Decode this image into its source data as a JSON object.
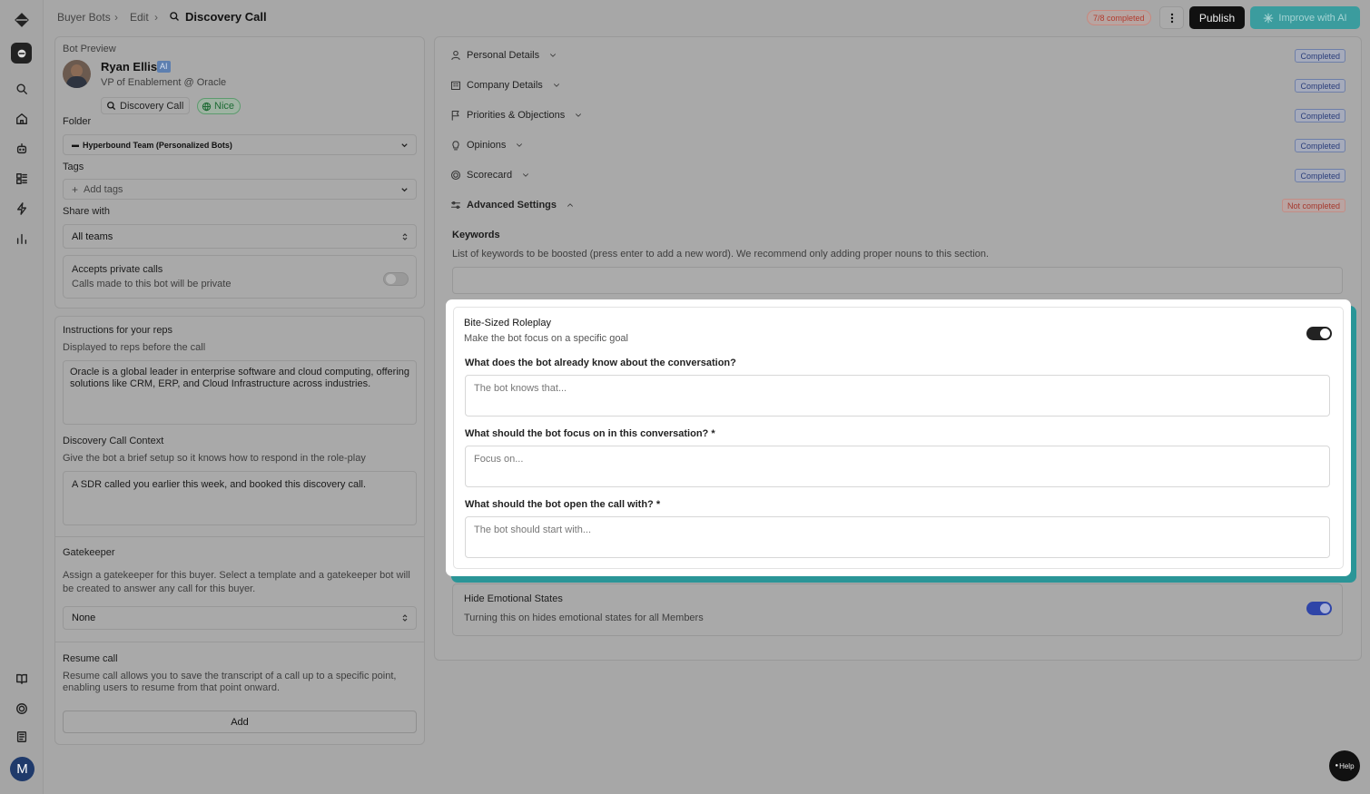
{
  "breadcrumb": {
    "root": "Buyer Bots",
    "edit": "Edit",
    "current": "Discovery Call"
  },
  "header": {
    "progress": "7/8 completed",
    "publish": "Publish",
    "improve": "Improve with AI"
  },
  "bot_preview": {
    "heading": "Bot Preview",
    "name": "Ryan Ellis",
    "ai_badge": "AI",
    "role": "VP of Enablement @ Oracle",
    "call_type": "Discovery Call",
    "mood": "Nice"
  },
  "folder": {
    "label": "Folder",
    "value": "Hyperbound Team (Personalized Bots)"
  },
  "tags": {
    "label": "Tags",
    "placeholder": "Add tags"
  },
  "share": {
    "label": "Share with",
    "value": "All teams"
  },
  "private_calls": {
    "title": "Accepts private calls",
    "desc": "Calls made to this bot will be private",
    "enabled": false
  },
  "instructions": {
    "title": "Instructions for your reps",
    "desc": "Displayed to reps before the call",
    "value": "Oracle is a global leader in enterprise software and cloud computing, offering solutions like CRM, ERP, and Cloud Infrastructure across industries."
  },
  "context": {
    "title": "Discovery Call Context",
    "desc": "Give the bot a brief setup so it knows how to respond in the role-play",
    "value": "A SDR called you earlier this week, and booked this discovery call."
  },
  "gatekeeper": {
    "title": "Gatekeeper",
    "desc": "Assign a gatekeeper for this buyer. Select a template and a gatekeeper bot will be created to answer any call for this buyer.",
    "value": "None"
  },
  "resume": {
    "title": "Resume call",
    "desc": "Resume call allows you to save the transcript of a call up to a specific point, enabling users to resume from that point onward.",
    "button": "Add"
  },
  "sections": [
    {
      "label": "Personal Details",
      "status": "Completed",
      "icon": "person-icon"
    },
    {
      "label": "Company Details",
      "status": "Completed",
      "icon": "building-icon"
    },
    {
      "label": "Priorities & Objections",
      "status": "Completed",
      "icon": "flag-icon"
    },
    {
      "label": "Opinions",
      "status": "Completed",
      "icon": "lightbulb-icon"
    },
    {
      "label": "Scorecard",
      "status": "Completed",
      "icon": "target-icon"
    },
    {
      "label": "Advanced Settings",
      "status": "Not completed",
      "icon": "sliders-icon"
    }
  ],
  "keywords": {
    "title": "Keywords",
    "desc": "List of keywords to be boosted (press enter to add a new word). We recommend only adding proper nouns to this section."
  },
  "bite_sized": {
    "title": "Bite-Sized Roleplay",
    "desc": "Make the bot focus on a specific goal",
    "enabled": true,
    "q1": "What does the bot already know about the conversation?",
    "q1_placeholder": "The bot knows that...",
    "q2": "What should the bot focus on in this conversation? *",
    "q2_placeholder": "Focus on...",
    "q3": "What should the bot open the call with? *",
    "q3_placeholder": "The bot should start with..."
  },
  "hide_emotional": {
    "title": "Hide Emotional States",
    "desc": "Turning this on hides emotional states for all Members",
    "enabled": true
  },
  "user_initial": "M",
  "help": "Help",
  "colors": {
    "accent": "#3b9c9e",
    "toggle_on_modal": "#222222",
    "toggle_on_blue": "#2f45a8"
  }
}
